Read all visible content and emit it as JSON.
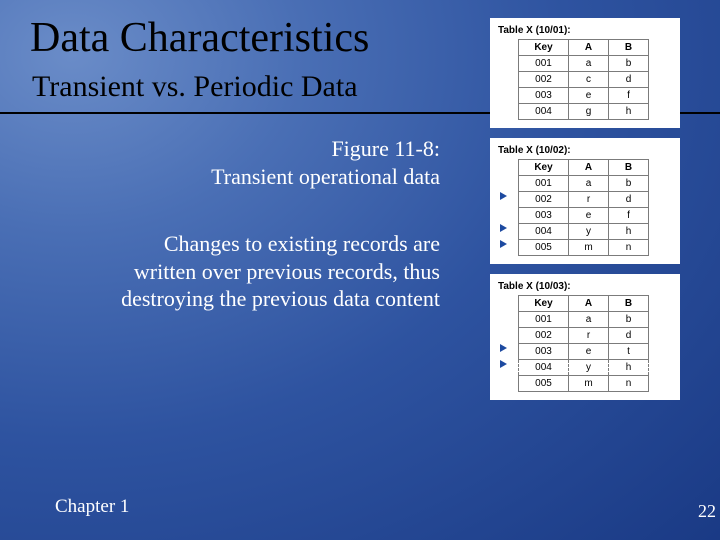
{
  "title": "Data Characteristics",
  "subtitle": "Transient vs. Periodic Data",
  "figure_caption_l1": "Figure 11-8:",
  "figure_caption_l2": "Transient operational data",
  "body_l1": "Changes to existing records are",
  "body_l2": "written over previous records, thus",
  "body_l3": "destroying the previous data content",
  "footer_left": "Chapter 1",
  "footer_right": "22",
  "tables": [
    {
      "caption": "Table X (10/01):",
      "headers": [
        "Key",
        "A",
        "B"
      ],
      "rows": [
        [
          "001",
          "a",
          "b"
        ],
        [
          "002",
          "c",
          "d"
        ],
        [
          "003",
          "e",
          "f"
        ],
        [
          "004",
          "g",
          "h"
        ]
      ],
      "markers": [],
      "dashed": []
    },
    {
      "caption": "Table X (10/02):",
      "headers": [
        "Key",
        "A",
        "B"
      ],
      "rows": [
        [
          "001",
          "a",
          "b"
        ],
        [
          "002",
          "r",
          "d"
        ],
        [
          "003",
          "e",
          "f"
        ],
        [
          "004",
          "y",
          "h"
        ],
        [
          "005",
          "m",
          "n"
        ]
      ],
      "markers": [
        1,
        3,
        4
      ],
      "dashed": []
    },
    {
      "caption": "Table X (10/03):",
      "headers": [
        "Key",
        "A",
        "B"
      ],
      "rows": [
        [
          "001",
          "a",
          "b"
        ],
        [
          "002",
          "r",
          "d"
        ],
        [
          "003",
          "e",
          "t"
        ],
        [
          "004",
          "y",
          "h"
        ],
        [
          "005",
          "m",
          "n"
        ]
      ],
      "markers": [
        2,
        3
      ],
      "dashed": [
        3
      ]
    }
  ]
}
